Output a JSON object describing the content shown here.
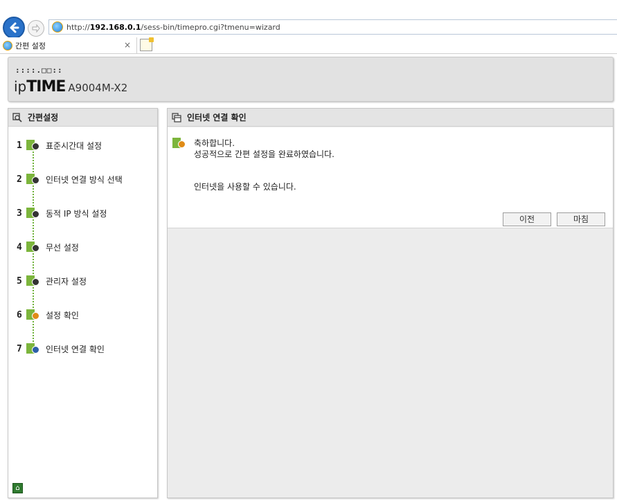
{
  "browser": {
    "url_prefix": "http://",
    "url_host": "192.168.0.1",
    "url_path": "/sess-bin/timepro.cgi?tmenu=wizard",
    "tab_title": "간편 설정",
    "tab_close": "×",
    "icons": {
      "back": "back-arrow-icon",
      "forward": "forward-arrow-icon",
      "ie": "ie-icon",
      "new_tab": "new-tab-icon"
    }
  },
  "header": {
    "logo_dots": "::::.□□::",
    "logo_ip": "ip",
    "logo_time": "TIME",
    "model": "A9004M-X2"
  },
  "sidebar": {
    "title": "간편설정",
    "steps": [
      {
        "num": "1",
        "label": "표준시간대 설정",
        "icon": "clock-icon"
      },
      {
        "num": "2",
        "label": "인터넷 연결 방식 선택",
        "icon": "network-icon"
      },
      {
        "num": "3",
        "label": "동적 IP 방식 설정",
        "icon": "ip-icon"
      },
      {
        "num": "4",
        "label": "무선 설정",
        "icon": "wireless-icon"
      },
      {
        "num": "5",
        "label": "관리자 설정",
        "icon": "admin-lock-icon"
      },
      {
        "num": "6",
        "label": "설정 확인",
        "icon": "settings-check-icon"
      },
      {
        "num": "7",
        "label": "인터넷 연결 확인",
        "icon": "globe-icon"
      }
    ],
    "home_icon": "home-icon"
  },
  "main": {
    "title": "인터넷 연결 확인",
    "line1": "축하합니다.",
    "line2": "성공적으로 간편 설정을 완료하였습니다.",
    "line3": "인터넷을 사용할 수 있습니다.",
    "btn_prev": "이전",
    "btn_finish": "마침"
  },
  "colors": {
    "step_green": "#7cb53c",
    "panel_head_bg": "#e4e4e4",
    "main_bg": "#ececec"
  }
}
